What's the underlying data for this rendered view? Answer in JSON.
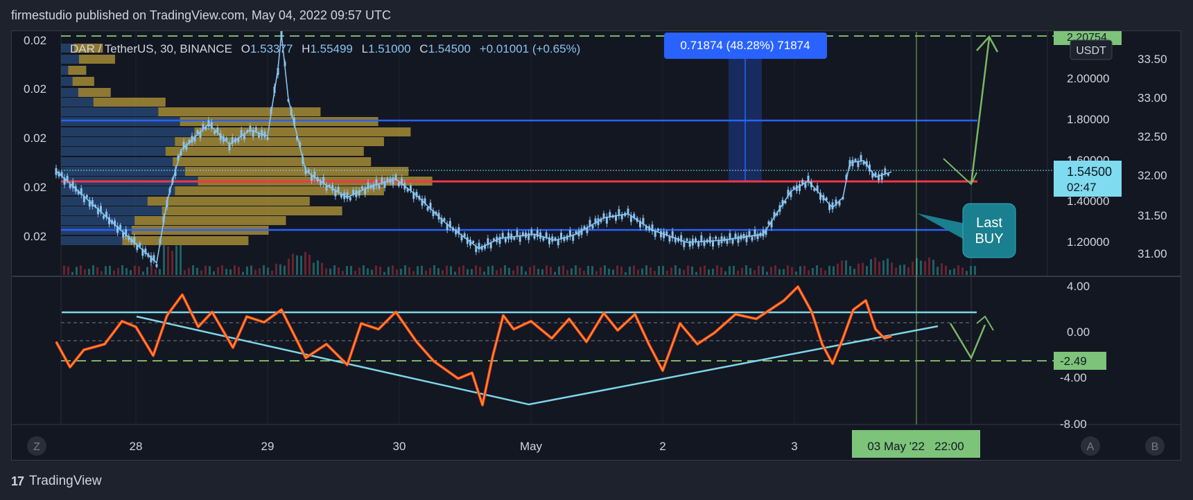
{
  "header": {
    "published": "firmestudio published on TradingView.com, May 04, 2022 09:57 UTC"
  },
  "footer": {
    "brand": "TradingView"
  },
  "legend": {
    "symbol": "DAR / TetherUS, 30, BINANCE",
    "open_label": "O",
    "open": "1.53377",
    "high_label": "H",
    "high": "1.55499",
    "low_label": "L",
    "low": "1.51000",
    "close_label": "C",
    "close": "1.54500",
    "change": "+0.01001 (+0.65%)"
  },
  "measure_label": "0.71874 (48.28%) 71874",
  "annotation": {
    "line1": "Last",
    "line2": "BUY"
  },
  "price_axis": {
    "labels": [
      "2.00000",
      "1.80000",
      "1.60000",
      "1.40000",
      "1.20000"
    ],
    "top_badge": "2.20754",
    "currency": "USDT",
    "current_price": "1.54500",
    "countdown": "02:47"
  },
  "right_axis": {
    "labels": [
      "33.50",
      "33.00",
      "32.50",
      "32.00",
      "31.50",
      "31.00"
    ]
  },
  "left_axis": {
    "labels": [
      "0.02",
      "0.02",
      "0.02",
      "0.02",
      "0.02"
    ]
  },
  "oscillator_axis": {
    "labels": [
      "4.00",
      "0.00",
      "-4.00",
      "-8.00"
    ],
    "badge": "-2.49"
  },
  "time_axis": {
    "labels": [
      "28",
      "29",
      "30",
      "May",
      "2",
      "3"
    ],
    "crosshair_label": "03 May '22   22:00"
  },
  "scale_buttons": {
    "left": "Z",
    "auto": "A",
    "b": "B"
  },
  "colors": {
    "background": "#131722",
    "up": "#8ac4f0",
    "level": "#2962ff",
    "support_red": "#f23645",
    "profile_gold": "#b89b3a",
    "profile_blue": "#2a4f7f",
    "osc_orange": "#ff9800",
    "osc_red": "#f23645",
    "trendline": "#7fd6e8",
    "arrow_green": "#7ab865",
    "badge_green": "#7dc37a",
    "price_badge": "#7fdbef"
  },
  "chart_data": {
    "type": "line",
    "symbol": "DAR/USDT",
    "timeframe": "30",
    "x_dates": [
      "28",
      "29",
      "30",
      "May",
      "2",
      "3"
    ],
    "y_ticks": [
      1.2,
      1.4,
      1.6,
      1.8,
      2.0
    ],
    "ylim": [
      1.08,
      2.28
    ],
    "horizontal_levels": [
      {
        "price": 1.79,
        "color": "#2962ff"
      },
      {
        "price": 1.5,
        "color": "#f23645"
      },
      {
        "price": 1.25,
        "color": "#2962ff"
      },
      {
        "price": 2.207,
        "color": "#7ab865",
        "style": "dashed"
      }
    ],
    "price_path": [
      {
        "x": 80,
        "y": 1.55
      },
      {
        "x": 225,
        "y": 1.1
      },
      {
        "x": 240,
        "y": 1.4
      },
      {
        "x": 260,
        "y": 1.65
      },
      {
        "x": 300,
        "y": 1.78
      },
      {
        "x": 330,
        "y": 1.68
      },
      {
        "x": 360,
        "y": 1.75
      },
      {
        "x": 385,
        "y": 1.72
      },
      {
        "x": 400,
        "y": 2.05
      },
      {
        "x": 405,
        "y": 2.22
      },
      {
        "x": 415,
        "y": 1.9
      },
      {
        "x": 440,
        "y": 1.55
      },
      {
        "x": 470,
        "y": 1.48
      },
      {
        "x": 500,
        "y": 1.42
      },
      {
        "x": 530,
        "y": 1.47
      },
      {
        "x": 570,
        "y": 1.51
      },
      {
        "x": 600,
        "y": 1.43
      },
      {
        "x": 640,
        "y": 1.3
      },
      {
        "x": 690,
        "y": 1.17
      },
      {
        "x": 720,
        "y": 1.22
      },
      {
        "x": 770,
        "y": 1.24
      },
      {
        "x": 800,
        "y": 1.21
      },
      {
        "x": 830,
        "y": 1.24
      },
      {
        "x": 870,
        "y": 1.32
      },
      {
        "x": 905,
        "y": 1.34
      },
      {
        "x": 940,
        "y": 1.26
      },
      {
        "x": 990,
        "y": 1.2
      },
      {
        "x": 1040,
        "y": 1.21
      },
      {
        "x": 1100,
        "y": 1.24
      },
      {
        "x": 1140,
        "y": 1.45
      },
      {
        "x": 1165,
        "y": 1.5
      },
      {
        "x": 1200,
        "y": 1.37
      },
      {
        "x": 1215,
        "y": 1.42
      },
      {
        "x": 1225,
        "y": 1.59
      },
      {
        "x": 1245,
        "y": 1.6
      },
      {
        "x": 1262,
        "y": 1.52
      },
      {
        "x": 1285,
        "y": 1.545
      }
    ],
    "oscillator": {
      "ylim": [
        -9,
        5
      ],
      "y_ticks": [
        4,
        0,
        -4,
        -8
      ],
      "value": -2.49,
      "path": [
        {
          "x": 80,
          "y": -0.8
        },
        {
          "x": 100,
          "y": -3.0
        },
        {
          "x": 120,
          "y": -1.5
        },
        {
          "x": 150,
          "y": -1.0
        },
        {
          "x": 175,
          "y": 1.0
        },
        {
          "x": 195,
          "y": 0.5
        },
        {
          "x": 220,
          "y": -2.0
        },
        {
          "x": 240,
          "y": 1.5
        },
        {
          "x": 262,
          "y": 3.3
        },
        {
          "x": 285,
          "y": 0.5
        },
        {
          "x": 305,
          "y": 1.8
        },
        {
          "x": 335,
          "y": -1.3
        },
        {
          "x": 355,
          "y": 1.4
        },
        {
          "x": 380,
          "y": 0.9
        },
        {
          "x": 405,
          "y": 2.0
        },
        {
          "x": 440,
          "y": -2.2
        },
        {
          "x": 470,
          "y": -1.0
        },
        {
          "x": 500,
          "y": -2.8
        },
        {
          "x": 520,
          "y": 0.8
        },
        {
          "x": 545,
          "y": 0.3
        },
        {
          "x": 570,
          "y": 1.8
        },
        {
          "x": 600,
          "y": -0.8
        },
        {
          "x": 625,
          "y": -2.5
        },
        {
          "x": 660,
          "y": -4.0
        },
        {
          "x": 680,
          "y": -3.5
        },
        {
          "x": 695,
          "y": -6.3
        },
        {
          "x": 710,
          "y": -2.0
        },
        {
          "x": 725,
          "y": 1.5
        },
        {
          "x": 740,
          "y": 0.3
        },
        {
          "x": 765,
          "y": 1.0
        },
        {
          "x": 795,
          "y": -0.5
        },
        {
          "x": 820,
          "y": 1.2
        },
        {
          "x": 845,
          "y": -0.8
        },
        {
          "x": 870,
          "y": 1.7
        },
        {
          "x": 890,
          "y": 0.2
        },
        {
          "x": 915,
          "y": 1.6
        },
        {
          "x": 935,
          "y": -1.0
        },
        {
          "x": 955,
          "y": -3.3
        },
        {
          "x": 980,
          "y": 0.8
        },
        {
          "x": 1005,
          "y": -1.0
        },
        {
          "x": 1030,
          "y": 0.0
        },
        {
          "x": 1060,
          "y": 1.6
        },
        {
          "x": 1090,
          "y": 1.2
        },
        {
          "x": 1110,
          "y": 2.0
        },
        {
          "x": 1130,
          "y": 2.8
        },
        {
          "x": 1150,
          "y": 4.0
        },
        {
          "x": 1170,
          "y": 1.8
        },
        {
          "x": 1185,
          "y": -1.0
        },
        {
          "x": 1200,
          "y": -2.7
        },
        {
          "x": 1215,
          "y": -0.5
        },
        {
          "x": 1230,
          "y": 2.0
        },
        {
          "x": 1248,
          "y": 2.8
        },
        {
          "x": 1262,
          "y": 0.3
        },
        {
          "x": 1275,
          "y": -0.5
        },
        {
          "x": 1285,
          "y": -0.3
        }
      ]
    }
  }
}
